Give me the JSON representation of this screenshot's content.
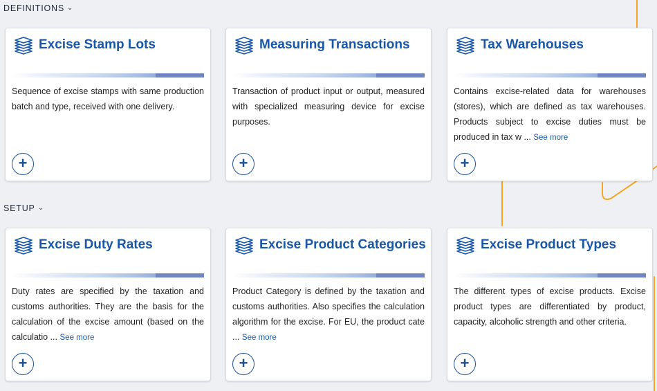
{
  "sections": [
    {
      "label": "DEFINITIONS",
      "cards": [
        {
          "title": "Excise Stamp Lots",
          "description": "Sequence of excise stamps with same production batch and type, received with one delivery.",
          "see_more": ""
        },
        {
          "title": "Measuring Transactions",
          "description": "Transaction of product input or output, measured with specialized measuring device for excise purposes.",
          "see_more": ""
        },
        {
          "title": "Tax Warehouses",
          "description": "Contains excise-related data for warehouses (stores), which are defined as tax warehouses. Products subject to excise duties must be produced in tax w ...",
          "see_more": "See more"
        }
      ]
    },
    {
      "label": "SETUP",
      "cards": [
        {
          "title": "Excise Duty Rates",
          "description": "Duty rates are specified by the taxation and customs authorities. They are the basis for the calculation of the excise amount (based on the calculatio ...",
          "see_more": "See more"
        },
        {
          "title": "Excise Product Categories",
          "description": "Product Category is defined by the taxation and customs authorities. Also specifies the calculation algorithm for the excise. For EU, the product cate ...",
          "see_more": "See more"
        },
        {
          "title": "Excise Product Types",
          "description": "The different types of excise products. Excise product types are differentiated by product, capacity, alcoholic strength and other criteria.",
          "see_more": ""
        }
      ]
    }
  ],
  "icons": {
    "card_icon": "layers-stack-icon",
    "section_toggle": "chevron-down-icon",
    "add_button": "plus-circle-icon"
  },
  "colors": {
    "title": "#1757a6",
    "accent_line": "#f2a623",
    "background": "#eef0f4"
  }
}
